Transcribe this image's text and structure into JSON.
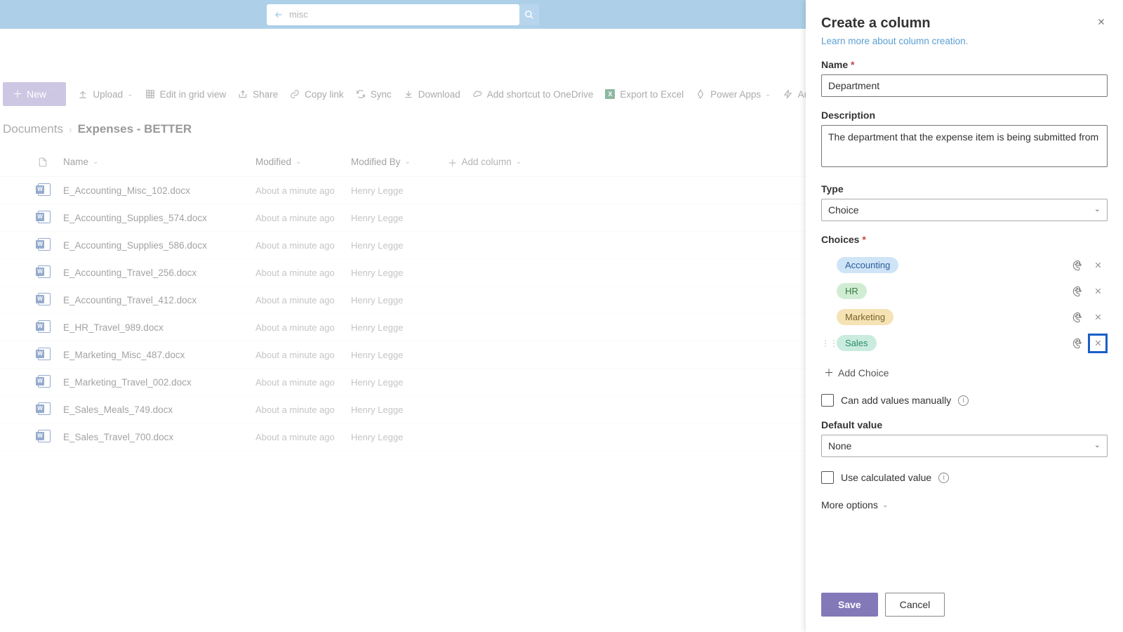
{
  "search": {
    "value": "misc"
  },
  "toolbar": {
    "new": "New",
    "upload": "Upload",
    "editgrid": "Edit in grid view",
    "share": "Share",
    "copylink": "Copy link",
    "sync": "Sync",
    "download": "Download",
    "shortcut": "Add shortcut to OneDrive",
    "excel": "Export to Excel",
    "powerapps": "Power Apps",
    "automate": "Automate"
  },
  "breadcrumb": {
    "root": "Documents",
    "current": "Expenses - BETTER"
  },
  "columns": {
    "name": "Name",
    "modified": "Modified",
    "modifiedby": "Modified By",
    "add": "Add column"
  },
  "rows": [
    {
      "name": "E_Accounting_Misc_102.docx",
      "modified": "About a minute ago",
      "by": "Henry Legge"
    },
    {
      "name": "E_Accounting_Supplies_574.docx",
      "modified": "About a minute ago",
      "by": "Henry Legge"
    },
    {
      "name": "E_Accounting_Supplies_586.docx",
      "modified": "About a minute ago",
      "by": "Henry Legge"
    },
    {
      "name": "E_Accounting_Travel_256.docx",
      "modified": "About a minute ago",
      "by": "Henry Legge"
    },
    {
      "name": "E_Accounting_Travel_412.docx",
      "modified": "About a minute ago",
      "by": "Henry Legge"
    },
    {
      "name": "E_HR_Travel_989.docx",
      "modified": "About a minute ago",
      "by": "Henry Legge"
    },
    {
      "name": "E_Marketing_Misc_487.docx",
      "modified": "About a minute ago",
      "by": "Henry Legge"
    },
    {
      "name": "E_Marketing_Travel_002.docx",
      "modified": "About a minute ago",
      "by": "Henry Legge"
    },
    {
      "name": "E_Sales_Meals_749.docx",
      "modified": "About a minute ago",
      "by": "Henry Legge"
    },
    {
      "name": "E_Sales_Travel_700.docx",
      "modified": "About a minute ago",
      "by": "Henry Legge"
    }
  ],
  "panel": {
    "title": "Create a column",
    "subtitle": "Learn more about column creation.",
    "name_label": "Name",
    "name_value": "Department",
    "desc_label": "Description",
    "desc_value": "The department that the expense item is being submitted from",
    "type_label": "Type",
    "type_value": "Choice",
    "choices_label": "Choices",
    "choices": [
      {
        "label": "Accounting",
        "bg": "#cfe4f7",
        "fg": "#2a5d9b"
      },
      {
        "label": "HR",
        "bg": "#d0edd3",
        "fg": "#3a7a45"
      },
      {
        "label": "Marketing",
        "bg": "#f5e3b5",
        "fg": "#7a6326"
      },
      {
        "label": "Sales",
        "bg": "#c9ecdf",
        "fg": "#2d8a6a"
      }
    ],
    "add_choice": "Add Choice",
    "manual": "Can add values manually",
    "default_label": "Default value",
    "default_value": "None",
    "calc": "Use calculated value",
    "more": "More options",
    "save": "Save",
    "cancel": "Cancel"
  }
}
